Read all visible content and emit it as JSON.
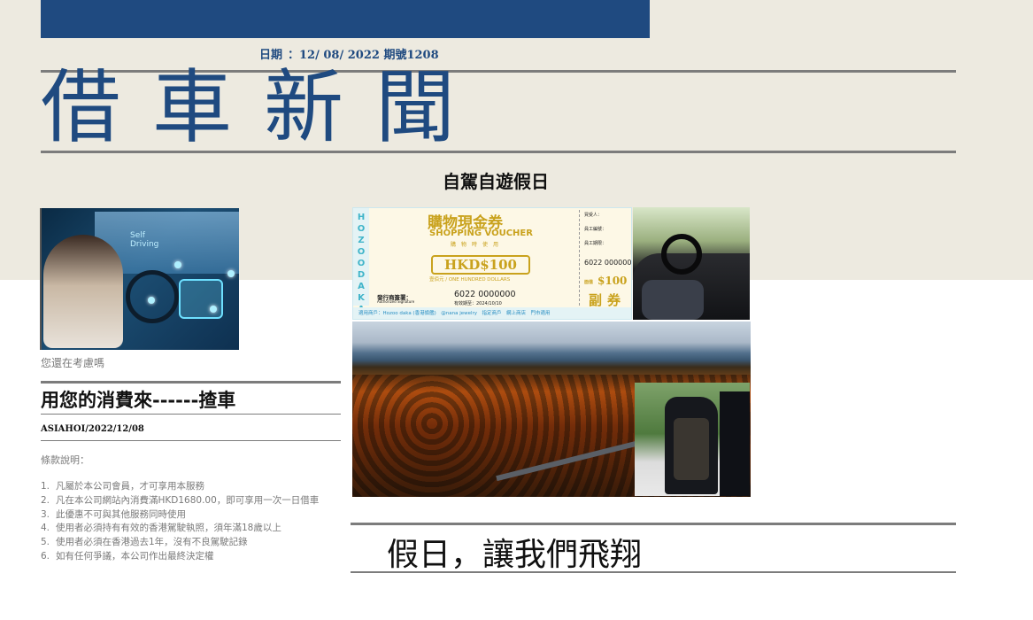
{
  "header": {
    "date_label": "日期",
    "date_value": "：12/ 08/ 2022 期號1208",
    "masthead": "借車新聞"
  },
  "section": {
    "title": "自駕自遊假日"
  },
  "left_column": {
    "image_caption": "您還在考慮嗎",
    "thumb_texts": [
      "Self",
      "Driving"
    ],
    "headline": "用您的消費來------揸車",
    "byline": "ASIAHOI/2022/12/08",
    "terms_title": "條款說明：",
    "terms": [
      {
        "num": "1.",
        "text": "凡屬於本公司會員，才可享用本服務"
      },
      {
        "num": "2.",
        "text": "凡在本公司網站內消費滿HKD1680.00，即可享用一次一日借車"
      },
      {
        "num": "3.",
        "text": "此優惠不可與其他服務同時使用"
      },
      {
        "num": "4.",
        "text": "使用者必須持有有效的香港駕駛執照，須年滿18歲以上"
      },
      {
        "num": "5.",
        "text": "使用者必須在香港過去1年，沒有不良駕駛記錄"
      },
      {
        "num": "6.",
        "text": "如有任何爭議，本公司作出最終決定權"
      }
    ]
  },
  "voucher": {
    "side_text": "HOZOO DAKA",
    "cn_title": "購物現金券",
    "en_title": "SHOPPING VOUCHER",
    "small_note": "購物時使用",
    "amount": "HKD$100",
    "amount_words": "壹佰元 / ONE HUNDRED DOLLARS",
    "issuer": "發行商簽署：",
    "authorized": "Authorized Signature",
    "serial": "6022 0000000",
    "valid": "有效期至：2024/10/10",
    "stub_buyer": "買受人：",
    "stub_staff_no": "員工編號：",
    "stub_staff_date": "員工期限：",
    "stub_serial": "6022 0000000",
    "stub_amount": "$100",
    "stub_amount_label": "面值",
    "stub_fu": "副券",
    "bottom_band": "適用商戶：Hozoo daka (香港旗艦)　@nana jewelry　指定商戶　網上商店　門市適用"
  },
  "bottom": {
    "headline": "假日，讓我們飛翔"
  },
  "colors": {
    "navy": "#1f4a80",
    "beige": "#edeae0",
    "gold": "#c9a21d"
  }
}
